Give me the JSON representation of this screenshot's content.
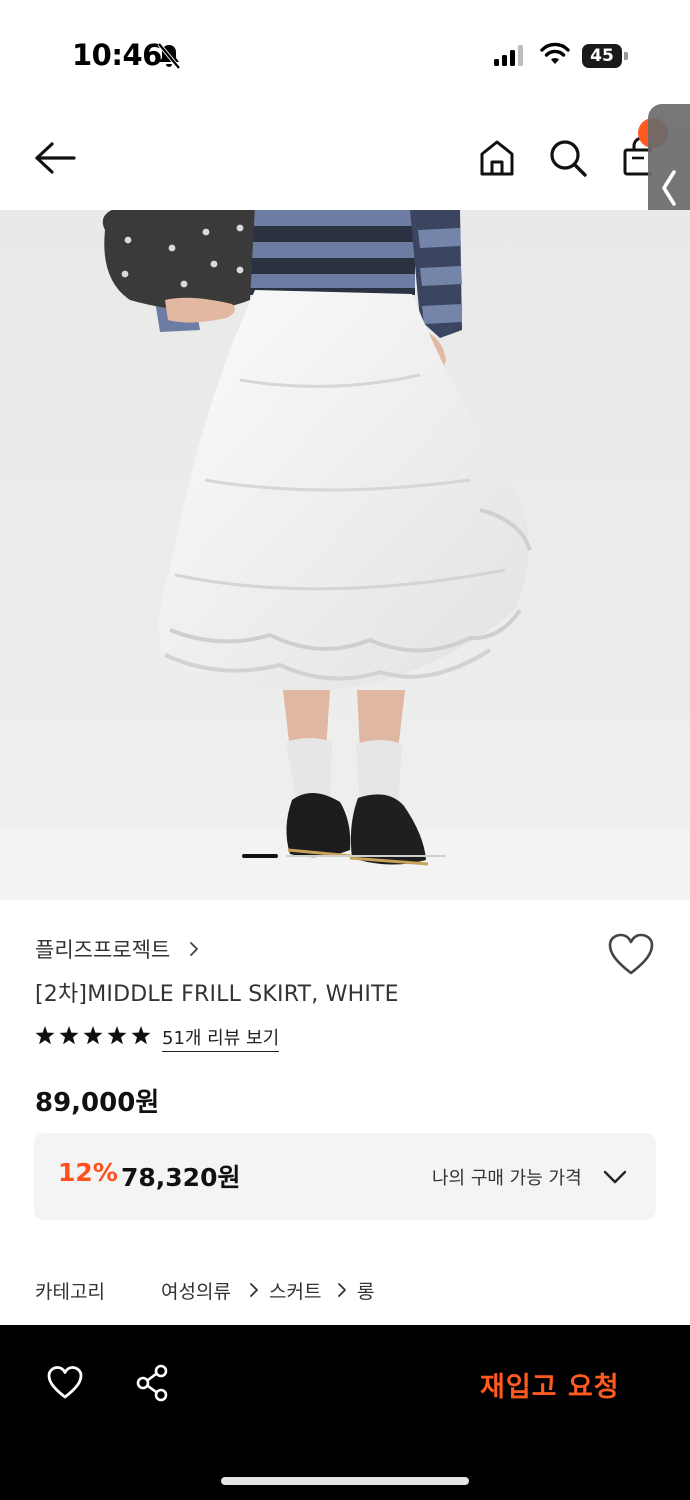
{
  "status_bar": {
    "time": "10:46",
    "battery": "45",
    "icons": [
      "bell-off-icon",
      "signal-icon",
      "wifi-icon",
      "battery-icon"
    ]
  },
  "nav": {
    "icons": [
      "back-arrow-icon",
      "home-icon",
      "search-icon",
      "shopping-bag-icon",
      "chevron-left-icon"
    ],
    "badge_color": "#ff5a1f"
  },
  "product": {
    "brand": "플리즈프로젝트",
    "title": "[2차]MIDDLE FRILL SKIRT, WHITE",
    "rating_stars": 5,
    "review_link": "51개 리뷰 보기",
    "price": "89,000원",
    "discount_percent": "12%",
    "discount_price": "78,320원",
    "my_price_label": "나의 구매 가능 가격",
    "image_page": 1,
    "accent_color": "#ff4f1c"
  },
  "category": {
    "label": "카테고리",
    "path": [
      "여성의류",
      "스커트",
      "롱"
    ]
  },
  "bottom_bar": {
    "restock_label": "재입고 요청",
    "icons": [
      "heart-icon",
      "share-icon"
    ],
    "accent_color": "#ff5a1f"
  }
}
